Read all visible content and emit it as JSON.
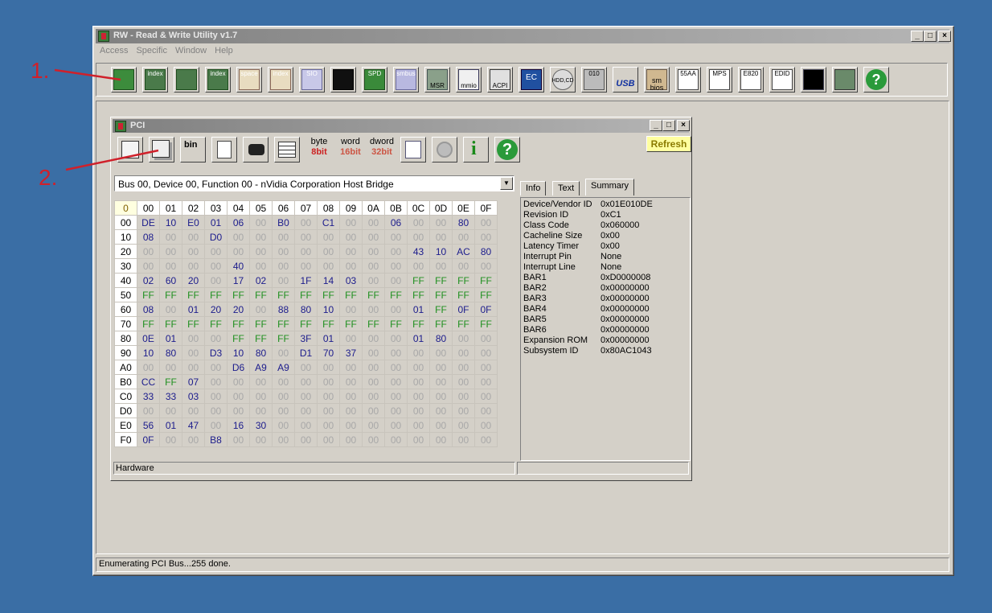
{
  "window": {
    "title": "RW - Read & Write Utility v1.7",
    "min": "_",
    "max": "□",
    "close": "×"
  },
  "menu": [
    "Access",
    "Specific",
    "Window",
    "Help"
  ],
  "toolbar": [
    {
      "name": "pci-icon",
      "label": ""
    },
    {
      "name": "index-io-icon",
      "label": "index"
    },
    {
      "name": "memory-icon",
      "label": ""
    },
    {
      "name": "index-memory-icon",
      "label": "index"
    },
    {
      "name": "io-space-icon",
      "label": "space"
    },
    {
      "name": "io-index-icon",
      "label": "index"
    },
    {
      "name": "sio-icon",
      "label": "SIO"
    },
    {
      "name": "oscilloscope-icon",
      "label": ""
    },
    {
      "name": "spd-icon",
      "label": "SPD"
    },
    {
      "name": "smbus-icon",
      "label": "smbus"
    },
    {
      "name": "msr-icon",
      "label": "MSR"
    },
    {
      "name": "mmio-icon",
      "label": "mmio"
    },
    {
      "name": "acpi-icon",
      "label": "ACPI"
    },
    {
      "name": "ec-icon",
      "label": "EC"
    },
    {
      "name": "hdd-cd-icon",
      "label": "HDD,CD"
    },
    {
      "name": "binary-disk-icon",
      "label": "010"
    },
    {
      "name": "usb-icon",
      "label": "USB"
    },
    {
      "name": "smbios-icon",
      "label": "sm bios"
    },
    {
      "name": "55aa-icon",
      "label": "55AA"
    },
    {
      "name": "mps-icon",
      "label": "MPS"
    },
    {
      "name": "e820-icon",
      "label": "E820"
    },
    {
      "name": "edid-icon",
      "label": "EDID"
    },
    {
      "name": "command-icon",
      "label": ""
    },
    {
      "name": "battery-icon",
      "label": ""
    },
    {
      "name": "help-icon",
      "label": "?"
    }
  ],
  "annotations": {
    "one": "1.",
    "two": "2."
  },
  "status": "Enumerating PCI Bus...255 done.",
  "pci": {
    "title": "PCI",
    "refresh": "Refresh",
    "byte": {
      "top": "byte",
      "bottom": "8bit"
    },
    "word": {
      "top": "word",
      "bottom": "16bit"
    },
    "dword": {
      "top": "dword",
      "bottom": "32bit"
    },
    "device": "Bus 00, Device 00, Function 00 - nVidia Corporation Host Bridge",
    "tabs": [
      "Info",
      "Text",
      "Summary"
    ],
    "hw_status": "Hardware",
    "grid": {
      "corner": "0",
      "cols": [
        "00",
        "01",
        "02",
        "03",
        "04",
        "05",
        "06",
        "07",
        "08",
        "09",
        "0A",
        "0B",
        "0C",
        "0D",
        "0E",
        "0F"
      ],
      "rows": [
        {
          "h": "00",
          "v": [
            "DE",
            "10",
            "E0",
            "01",
            "06",
            "00",
            "B0",
            "00",
            "C1",
            "00",
            "00",
            "06",
            "00",
            "00",
            "80",
            "00"
          ]
        },
        {
          "h": "10",
          "v": [
            "08",
            "00",
            "00",
            "D0",
            "00",
            "00",
            "00",
            "00",
            "00",
            "00",
            "00",
            "00",
            "00",
            "00",
            "00",
            "00"
          ]
        },
        {
          "h": "20",
          "v": [
            "00",
            "00",
            "00",
            "00",
            "00",
            "00",
            "00",
            "00",
            "00",
            "00",
            "00",
            "00",
            "43",
            "10",
            "AC",
            "80"
          ]
        },
        {
          "h": "30",
          "v": [
            "00",
            "00",
            "00",
            "00",
            "40",
            "00",
            "00",
            "00",
            "00",
            "00",
            "00",
            "00",
            "00",
            "00",
            "00",
            "00"
          ]
        },
        {
          "h": "40",
          "v": [
            "02",
            "60",
            "20",
            "00",
            "17",
            "02",
            "00",
            "1F",
            "14",
            "03",
            "00",
            "00",
            "FF",
            "FF",
            "FF",
            "FF"
          ]
        },
        {
          "h": "50",
          "v": [
            "FF",
            "FF",
            "FF",
            "FF",
            "FF",
            "FF",
            "FF",
            "FF",
            "FF",
            "FF",
            "FF",
            "FF",
            "FF",
            "FF",
            "FF",
            "FF"
          ]
        },
        {
          "h": "60",
          "v": [
            "08",
            "00",
            "01",
            "20",
            "20",
            "00",
            "88",
            "80",
            "10",
            "00",
            "00",
            "00",
            "01",
            "FF",
            "0F",
            "0F"
          ]
        },
        {
          "h": "70",
          "v": [
            "FF",
            "FF",
            "FF",
            "FF",
            "FF",
            "FF",
            "FF",
            "FF",
            "FF",
            "FF",
            "FF",
            "FF",
            "FF",
            "FF",
            "FF",
            "FF"
          ]
        },
        {
          "h": "80",
          "v": [
            "0E",
            "01",
            "00",
            "00",
            "FF",
            "FF",
            "FF",
            "3F",
            "01",
            "00",
            "00",
            "00",
            "01",
            "80",
            "00",
            "00"
          ]
        },
        {
          "h": "90",
          "v": [
            "10",
            "80",
            "00",
            "D3",
            "10",
            "80",
            "00",
            "D1",
            "70",
            "37",
            "00",
            "00",
            "00",
            "00",
            "00",
            "00"
          ]
        },
        {
          "h": "A0",
          "v": [
            "00",
            "00",
            "00",
            "00",
            "D6",
            "A9",
            "A9",
            "00",
            "00",
            "00",
            "00",
            "00",
            "00",
            "00",
            "00",
            "00"
          ]
        },
        {
          "h": "B0",
          "v": [
            "CC",
            "FF",
            "07",
            "00",
            "00",
            "00",
            "00",
            "00",
            "00",
            "00",
            "00",
            "00",
            "00",
            "00",
            "00",
            "00"
          ]
        },
        {
          "h": "C0",
          "v": [
            "33",
            "33",
            "03",
            "00",
            "00",
            "00",
            "00",
            "00",
            "00",
            "00",
            "00",
            "00",
            "00",
            "00",
            "00",
            "00"
          ]
        },
        {
          "h": "D0",
          "v": [
            "00",
            "00",
            "00",
            "00",
            "00",
            "00",
            "00",
            "00",
            "00",
            "00",
            "00",
            "00",
            "00",
            "00",
            "00",
            "00"
          ]
        },
        {
          "h": "E0",
          "v": [
            "56",
            "01",
            "47",
            "00",
            "16",
            "30",
            "00",
            "00",
            "00",
            "00",
            "00",
            "00",
            "00",
            "00",
            "00",
            "00"
          ]
        },
        {
          "h": "F0",
          "v": [
            "0F",
            "00",
            "00",
            "B8",
            "00",
            "00",
            "00",
            "00",
            "00",
            "00",
            "00",
            "00",
            "00",
            "00",
            "00",
            "00"
          ]
        }
      ]
    },
    "summary": [
      {
        "k": "Device/Vendor ID",
        "v": "0x01E010DE"
      },
      {
        "k": "Revision ID",
        "v": "0xC1"
      },
      {
        "k": "Class Code",
        "v": "0x060000"
      },
      {
        "k": "Cacheline Size",
        "v": "0x00"
      },
      {
        "k": "Latency Timer",
        "v": "0x00"
      },
      {
        "k": "Interrupt Pin",
        "v": "None"
      },
      {
        "k": "Interrupt Line",
        "v": "None"
      },
      {
        "k": "BAR1",
        "v": "0xD0000008"
      },
      {
        "k": "BAR2",
        "v": "0x00000000"
      },
      {
        "k": "BAR3",
        "v": "0x00000000"
      },
      {
        "k": "BAR4",
        "v": "0x00000000"
      },
      {
        "k": "BAR5",
        "v": "0x00000000"
      },
      {
        "k": "BAR6",
        "v": "0x00000000"
      },
      {
        "k": "Expansion ROM",
        "v": "0x00000000"
      },
      {
        "k": "Subsystem ID",
        "v": "0x80AC1043"
      }
    ]
  }
}
